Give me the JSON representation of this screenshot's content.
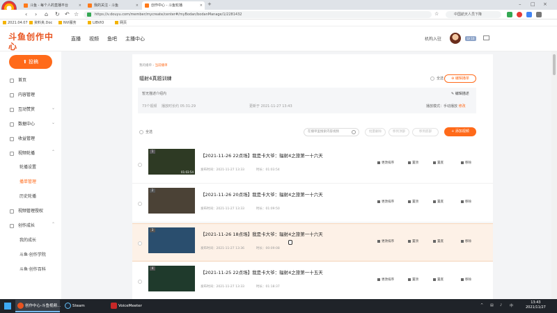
{
  "browser": {
    "brand_badge": "趣味模板",
    "tabs": [
      {
        "label": "斗鱼 - 每个人的直播平台"
      },
      {
        "label": "我的关注 - 斗鱼"
      },
      {
        "label": "创作中心 - 斗鱼轮播"
      }
    ],
    "url": "https://v.douyu.com/member/mycreate/center#/myBodan/bodanManage/1/2281432",
    "search_placeholder": "中国航天人员下降",
    "bookmarks": [
      "2021.04.07",
      "资料夹.Doc",
      "NVI服务",
      "LIBVIO",
      "网页"
    ]
  },
  "site": {
    "logo_main": "斗鱼创作中心",
    "logo_sub": "DOUYU CREATION CENTER",
    "nav": [
      "直播",
      "视频",
      "鱼吧",
      "主播中心"
    ],
    "user_link": "机构入驻",
    "level_badge": "LV 10"
  },
  "sidebar": {
    "upload_label": "投稿",
    "items": [
      {
        "label": "首页"
      },
      {
        "label": "内容管理"
      },
      {
        "label": "互动赞赏"
      },
      {
        "label": "数据中心"
      },
      {
        "label": "收益管理"
      },
      {
        "label": "视频轮播"
      },
      {
        "label": "视频管理授权"
      },
      {
        "label": "创作成长"
      }
    ],
    "sub_items": [
      {
        "label": "轮播设置",
        "active": false
      },
      {
        "label": "播单管理",
        "active": true
      },
      {
        "label": "历史轮播",
        "active": false
      },
      {
        "label": "我的成长",
        "active": false
      },
      {
        "label": "斗鱼·创作学院",
        "active": false
      },
      {
        "label": "斗鱼·创作百科",
        "active": false
      }
    ]
  },
  "main": {
    "breadcrumb_root": "我的播单",
    "breadcrumb_current": "当前播单",
    "page_title": "辐射4真题训練",
    "select_label": "全选",
    "edit_button": "编辑播单",
    "info": {
      "desc": "暂无描述介绍内",
      "edit_link": "编辑描述",
      "meta_count": "73个视频",
      "meta_duration": "播放时长约 05:31:29",
      "updated": "更新于 2021-11-27 13:43",
      "mode_label": "播放模式：手动播放",
      "mode_action": "修改"
    },
    "toolbar": {
      "all_label": "全选",
      "search_placeholder": "在播单里搜索内容视频",
      "btn_batch_delete": "批量删除",
      "btn_move_top": "移到顶部",
      "btn_move_bottom": "移到底部",
      "btn_add": "+ 添加视频"
    },
    "rows": [
      {
        "num": "1",
        "title": "【2021-11-26 22点场】我是卡大爷：辐射4之旅第一十六天",
        "date": "发布时间：2021-11-27 13:33",
        "duration": "时长：01:03:54",
        "thumb_dur": "01:03:54",
        "thumb_color": "#2e3a24"
      },
      {
        "num": "2",
        "title": "【2021-11-26 20点场】我是卡大爷：辐射4之旅第一十六天",
        "date": "发布时间：2021-11-27 13:33",
        "duration": "时长：01:09:50",
        "thumb_color": "#4b4236"
      },
      {
        "num": "3",
        "title": "【2021-11-26 18点场】我是卡大爷：辐射4之旅第一十六天",
        "date": "发布时间：2021-11-27 13:36",
        "duration": "时长：00:09:08",
        "thumb_color": "#2a4e6e"
      },
      {
        "num": "4",
        "title": "【2021-11-25 22点场】我是卡大爷：辐射4之旅第一十五天",
        "date": "发布时间：2021-11-27 13:33",
        "duration": "时长：01:18:37",
        "thumb_color": "#1f3a2c"
      }
    ],
    "row_actions": [
      "更改排序",
      "置顶",
      "置底",
      "移除"
    ]
  },
  "taskbar": {
    "apps": [
      {
        "label": "创作中心-斗鱼视频...",
        "active": true,
        "color": "#e8531f"
      },
      {
        "label": "Steam",
        "active": false,
        "color": "#1b2838"
      },
      {
        "label": "VoiceMeeter",
        "active": false,
        "color": "#c62828"
      }
    ],
    "time": "13:43",
    "date": "2021/11/27"
  }
}
